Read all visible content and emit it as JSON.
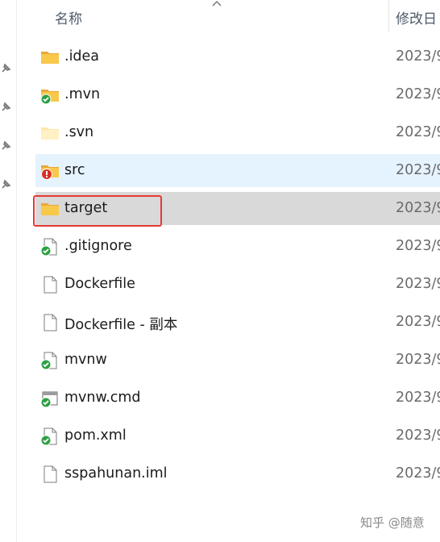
{
  "header": {
    "name_col": "名称",
    "date_col": "修改日"
  },
  "files": [
    {
      "name": ".idea",
      "icon": "folder-icon",
      "date": "2023/9",
      "state": "normal"
    },
    {
      "name": ".mvn",
      "icon": "folder-svn-ok-icon",
      "date": "2023/9",
      "state": "normal"
    },
    {
      "name": ".svn",
      "icon": "folder-light-icon",
      "date": "2023/9",
      "state": "normal"
    },
    {
      "name": "src",
      "icon": "folder-svn-conflict-icon",
      "date": "2023/9",
      "state": "selected"
    },
    {
      "name": "target",
      "icon": "folder-icon",
      "date": "2023/9",
      "state": "highlighted"
    },
    {
      "name": ".gitignore",
      "icon": "file-svn-ok-icon",
      "date": "2023/9",
      "state": "normal"
    },
    {
      "name": "Dockerfile",
      "icon": "file-icon",
      "date": "2023/9",
      "state": "normal"
    },
    {
      "name": "Dockerfile - 副本",
      "icon": "file-icon",
      "date": "2023/9",
      "state": "normal"
    },
    {
      "name": "mvnw",
      "icon": "file-svn-ok-icon",
      "date": "2023/9",
      "state": "normal"
    },
    {
      "name": "mvnw.cmd",
      "icon": "cmd-file-svn-ok-icon",
      "date": "2023/9",
      "state": "normal"
    },
    {
      "name": "pom.xml",
      "icon": "file-svn-ok-icon",
      "date": "2023/9",
      "state": "normal"
    },
    {
      "name": "sspahunan.iml",
      "icon": "file-icon",
      "date": "2023/9",
      "state": "normal"
    }
  ],
  "watermark": "知乎 @随意",
  "colors": {
    "folder": "#f8c84a",
    "selected_row": "#e5f3ff",
    "highlighted_row": "#d9d9d9",
    "annotation_box": "#e53935",
    "svn_ok": "#2ea043",
    "svn_conflict": "#d93025"
  }
}
